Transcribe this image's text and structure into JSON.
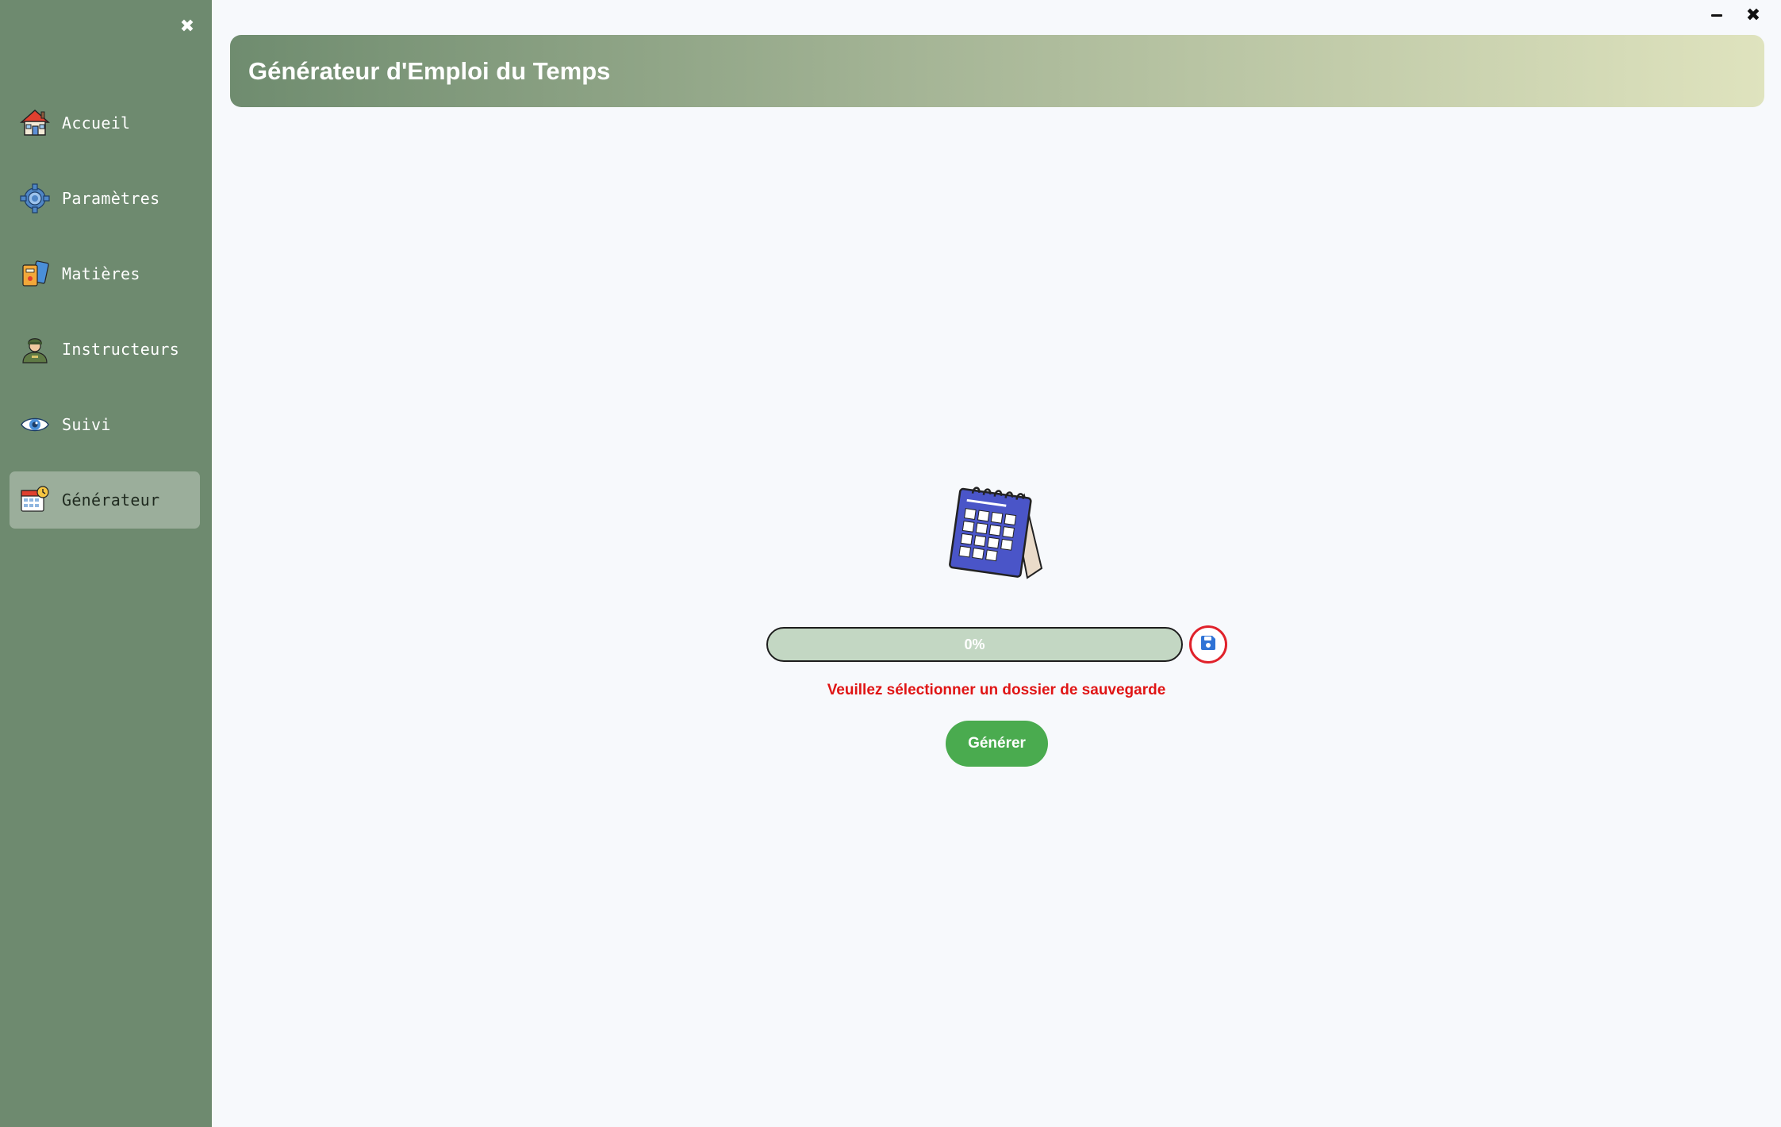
{
  "sidebar": {
    "close_icon": "close-icon",
    "items": [
      {
        "label": "Accueil",
        "icon": "house-icon",
        "active": false
      },
      {
        "label": "Paramètres",
        "icon": "gear-icon",
        "active": false
      },
      {
        "label": "Matières",
        "icon": "books-icon",
        "active": false
      },
      {
        "label": "Instructeurs",
        "icon": "soldier-icon",
        "active": false
      },
      {
        "label": "Suivi",
        "icon": "eye-icon",
        "active": false
      },
      {
        "label": "Générateur",
        "icon": "calendar-clock-icon",
        "active": true
      }
    ]
  },
  "window": {
    "minimize_icon": "minimize-icon",
    "close_icon": "close-icon"
  },
  "header": {
    "title": "Générateur d'Emploi du Temps"
  },
  "main": {
    "hero_icon": "calendar-icon",
    "progress": {
      "value": 0,
      "label": "0%"
    },
    "save_icon": "floppy-disk-icon",
    "error_message": "Veuillez sélectionner un dossier de sauvegarde",
    "generate_label": "Générer"
  },
  "colors": {
    "sidebar_bg": "#6e8a6f",
    "active_item_bg": "#9bae9b",
    "header_gradient_start": "#6f8c6f",
    "header_gradient_end": "#dfe3be",
    "progress_track": "#c3d7c3",
    "accent_green": "#4aab4f",
    "error_red": "#e01515"
  }
}
